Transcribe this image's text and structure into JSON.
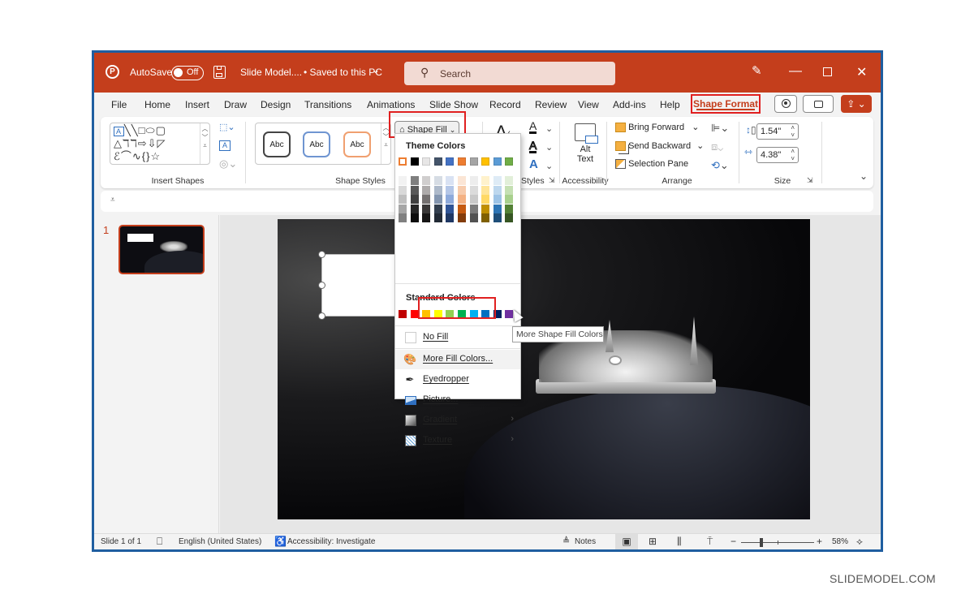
{
  "titlebar": {
    "autosave_label": "AutoSave",
    "autosave_state": "Off",
    "doc_name": "Slide Model....",
    "save_status": "• Saved to this PC",
    "search_placeholder": "Search",
    "brand_color": "#c43e1c"
  },
  "menu": {
    "tabs": [
      {
        "label": "File"
      },
      {
        "label": "Home"
      },
      {
        "label": "Insert"
      },
      {
        "label": "Draw"
      },
      {
        "label": "Design"
      },
      {
        "label": "Transitions"
      },
      {
        "label": "Animations"
      },
      {
        "label": "Slide Show"
      },
      {
        "label": "Record"
      },
      {
        "label": "Review"
      },
      {
        "label": "View"
      },
      {
        "label": "Add-ins"
      },
      {
        "label": "Help"
      },
      {
        "label": "Shape Format",
        "active": true
      }
    ]
  },
  "ribbon": {
    "insert_shapes_label": "Insert Shapes",
    "shape_styles_label": "Shape Styles",
    "style_sample": "Abc",
    "shape_fill_label": "Shape Fill",
    "wordart_label": "Styles",
    "alt_text_line1": "Alt",
    "alt_text_line2": "Text",
    "accessibility_label": "Accessibility",
    "bring_forward": "Bring Forward",
    "send_backward": "Send Backward",
    "selection_pane": "Selection Pane",
    "arrange_label": "Arrange",
    "height_value": "1.54\"",
    "width_value": "4.38\"",
    "size_label": "Size"
  },
  "shape_fill_menu": {
    "theme_colors_label": "Theme Colors",
    "theme_colors": [
      "#ffffff",
      "#000000",
      "#e7e6e6",
      "#44546a",
      "#4472c4",
      "#ed7d31",
      "#a5a5a5",
      "#ffc000",
      "#5b9bd5",
      "#70ad47"
    ],
    "theme_tints": [
      [
        "#f2f2f2",
        "#d9d9d9",
        "#bfbfbf",
        "#a6a6a6",
        "#808080"
      ],
      [
        "#7f7f7f",
        "#595959",
        "#404040",
        "#262626",
        "#0d0d0d"
      ],
      [
        "#d0cece",
        "#aeabab",
        "#757171",
        "#3a3838",
        "#171616"
      ],
      [
        "#d6dce4",
        "#adb9ca",
        "#8496b0",
        "#333f4f",
        "#222a35"
      ],
      [
        "#d9e2f3",
        "#b4c6e7",
        "#8eaadb",
        "#2f5496",
        "#1f3864"
      ],
      [
        "#fbe5d5",
        "#f7cbac",
        "#f4b183",
        "#c55a11",
        "#833c0b"
      ],
      [
        "#ededed",
        "#dbdbdb",
        "#c9c9c9",
        "#7b7b7b",
        "#525252"
      ],
      [
        "#fff2cc",
        "#ffe598",
        "#ffd965",
        "#bf8f00",
        "#7f6000"
      ],
      [
        "#deebf6",
        "#bdd7ee",
        "#9dc3e6",
        "#2e75b5",
        "#1f4e79"
      ],
      [
        "#e2efd9",
        "#c5e0b3",
        "#a8d08d",
        "#538135",
        "#375623"
      ]
    ],
    "standard_colors_label": "Standard Colors",
    "standard_colors": [
      "#c00000",
      "#ff0000",
      "#ffc000",
      "#ffff00",
      "#92d050",
      "#00b050",
      "#00b0f0",
      "#0070c0",
      "#002060",
      "#7030a0"
    ],
    "items": [
      {
        "label": "No Fill",
        "icon": "empty-square-icon"
      },
      {
        "label": "More Fill Colors...",
        "icon": "palette-icon",
        "highlighted": true
      },
      {
        "label": "Eyedropper",
        "icon": "eyedropper-icon"
      },
      {
        "label": "Picture...",
        "icon": "picture-icon"
      },
      {
        "label": "Gradient",
        "icon": "gradient-icon",
        "submenu": true
      },
      {
        "label": "Texture",
        "icon": "texture-icon",
        "submenu": true
      }
    ],
    "tooltip": "More Shape Fill Colors"
  },
  "thumbnails": [
    {
      "number": "1"
    }
  ],
  "statusbar": {
    "slide_count": "Slide 1 of 1",
    "language": "English (United States)",
    "accessibility": "Accessibility: Investigate",
    "notes": "Notes",
    "zoom_level": "58%",
    "zoom_minus": "−",
    "zoom_plus": "+"
  },
  "watermark": "SLIDEMODEL.COM"
}
